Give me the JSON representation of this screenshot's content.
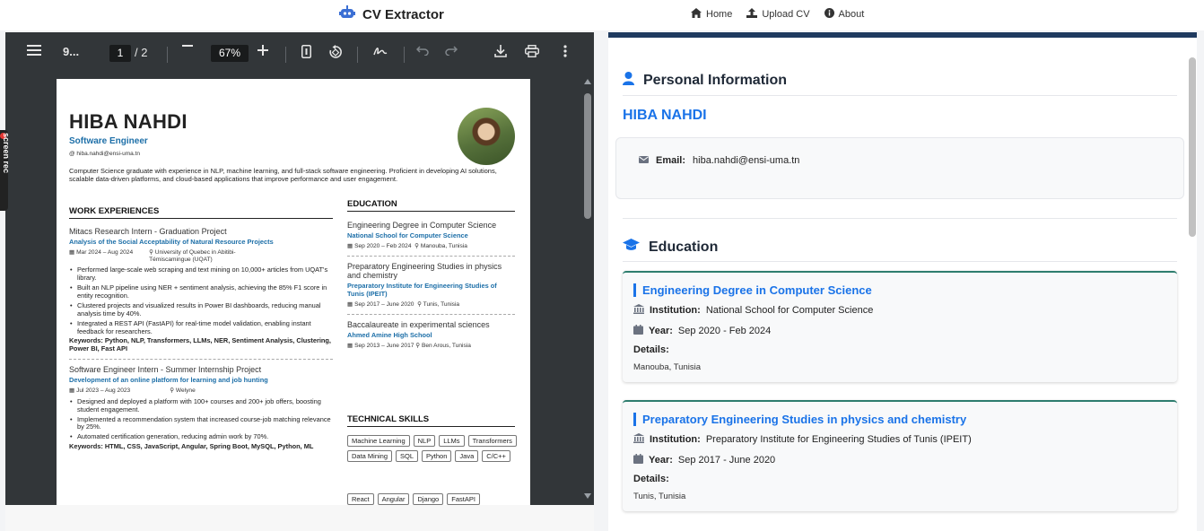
{
  "navbar": {
    "brand": "CV Extractor",
    "links": [
      {
        "label": "Home",
        "icon": "home-icon"
      },
      {
        "label": "Upload CV",
        "icon": "upload-icon"
      },
      {
        "label": "About",
        "icon": "info-icon"
      }
    ]
  },
  "viewer": {
    "file_name": "9...",
    "current_page": "1",
    "total_pages": "/ 2",
    "zoom": "67%"
  },
  "document": {
    "name": "HIBA NAHDI",
    "role": "Software Engineer",
    "email": "hiba.nahdi@ensi-uma.tn",
    "summary": "Computer Science graduate with experience in NLP, machine learning, and full-stack software engineering. Proficient in developing AI solutions, scalable data-driven platforms, and cloud-based applications that improve performance and user engagement.",
    "work_heading": "WORK EXPERIENCES",
    "work": [
      {
        "title": "Mitacs Research Intern - Graduation Project",
        "subtitle": "Analysis of the Social Acceptability of Natural Resource Projects",
        "dates": "Mar 2024 – Aug 2024",
        "location": "University of Quebec in Abitibi-Témiscamingue (UQAT)",
        "bullets": [
          "Performed large-scale web scraping and text mining on 10,000+ articles from UQAT's library.",
          "Built an NLP pipeline using NER + sentiment analysis, achieving the 85% F1 score in entity recognition.",
          "Clustered projects and visualized results in Power BI dashboards, reducing manual analysis time by 40%.",
          "Integrated a REST API (FastAPI) for real-time model validation, enabling instant feedback for researchers."
        ],
        "keywords": "Keywords: Python, NLP, Transformers, LLMs, NER, Sentiment Analysis, Clustering, Power BI, Fast API"
      },
      {
        "title": "Software Engineer Intern - Summer Internship Project",
        "subtitle": "Development of an online platform for learning and job hunting",
        "dates": "Jul 2023 – Aug 2023",
        "location": "Welyne",
        "bullets": [
          "Designed and deployed a platform with 100+ courses and 200+ job offers, boosting student engagement.",
          "Implemented a recommendation system that increased course-job matching relevance by 25%.",
          "Automated certification generation, reducing admin work by 70%."
        ],
        "keywords": "Keywords: HTML, CSS, JavaScript, Angular, Spring Boot, MySQL, Python, ML"
      }
    ],
    "education_heading": "EDUCATION",
    "education": [
      {
        "degree": "Engineering Degree in Computer Science",
        "school": "National School for Computer Science",
        "dates": "Sep 2020 – Feb 2024",
        "location": "Manouba, Tunisia"
      },
      {
        "degree": "Preparatory Engineering Studies in physics and chemistry",
        "school": "Preparatory Institute for Engineering Studies of Tunis (IPEIT)",
        "dates": "Sep 2017 – June 2020",
        "location": "Tunis, Tunisia"
      },
      {
        "degree": "Baccalaureate in experimental sciences",
        "school": "Ahmed Amine High School",
        "dates": "Sep 2013 – June 2017",
        "location": "Ben Arous, Tunisia"
      }
    ],
    "skills_heading": "TECHNICAL SKILLS",
    "skills_row1": [
      "Machine Learning",
      "NLP",
      "LLMs",
      "Transformers",
      "Data Mining",
      "SQL",
      "Python",
      "Java",
      "C/C++"
    ],
    "skills_row2": [
      "React",
      "Angular",
      "Django",
      "FastAPI"
    ]
  },
  "extracted": {
    "personal_heading": "Personal Information",
    "name": "HIBA NAHDI",
    "email_label": "Email:",
    "email_value": "hiba.nahdi@ensi-uma.tn",
    "education_heading": "Education",
    "institution_label": "Institution:",
    "year_label": "Year:",
    "details_label": "Details:",
    "education": [
      {
        "title": "Engineering Degree in Computer Science",
        "institution": "National School for Computer Science",
        "year": "Sep 2020 - Feb 2024",
        "details": "Manouba, Tunisia"
      },
      {
        "title": "Preparatory Engineering Studies in physics and chemistry",
        "institution": "Preparatory Institute for Engineering Studies of Tunis (IPEIT)",
        "year": "Sep 2017 - June 2020",
        "details": "Tunis, Tunisia"
      }
    ]
  },
  "screen_rec": {
    "label": "screen rec"
  },
  "colors": {
    "accent": "#1a73e8",
    "header_bar": "#1f3a5f",
    "viewer_bg": "#323639",
    "edu_border": "#2e7d6e"
  }
}
